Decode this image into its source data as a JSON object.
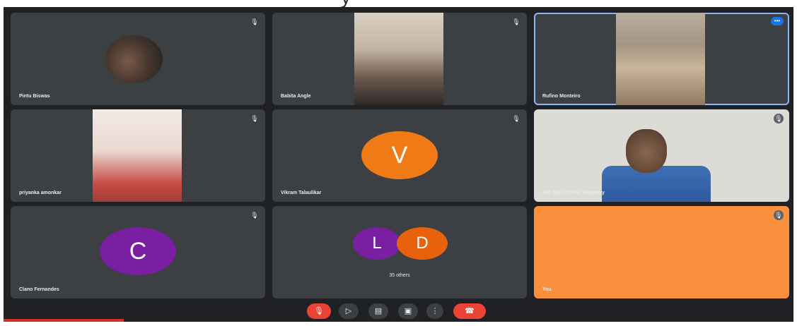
{
  "banner": {
    "text": "y"
  },
  "tiles": [
    {
      "name": "Pintu Biswas"
    },
    {
      "name": "Babita Angle"
    },
    {
      "name": "Rufino Monteiro"
    },
    {
      "name": "priyanka amonkar"
    },
    {
      "name": "Vikram Talaulikar",
      "initial": "V"
    },
    {
      "name": "IMA GOA STATE Secretary"
    },
    {
      "name": "Clano Fernandes",
      "initial": "C"
    },
    {
      "others_label": "35 others",
      "initials": [
        "L",
        "D"
      ]
    },
    {
      "name": "You"
    }
  ],
  "controls": [
    {
      "icon": "mic-off-icon",
      "glyph": "🎙"
    },
    {
      "icon": "camera-icon",
      "glyph": "▷"
    },
    {
      "icon": "captions-icon",
      "glyph": "▤"
    },
    {
      "icon": "present-icon",
      "glyph": "▣"
    },
    {
      "icon": "more-icon",
      "glyph": "⋮"
    },
    {
      "icon": "hangup-icon",
      "glyph": "☎"
    }
  ],
  "colors": {
    "background": "#202124",
    "tile": "#3c4043",
    "self_tile": "#fa903e",
    "avatar_v": "#f07b16",
    "avatar_purple": "#7b1fa2",
    "avatar_d": "#e8620e",
    "active_outline": "#8ab4f8",
    "hangup": "#ea4335"
  }
}
